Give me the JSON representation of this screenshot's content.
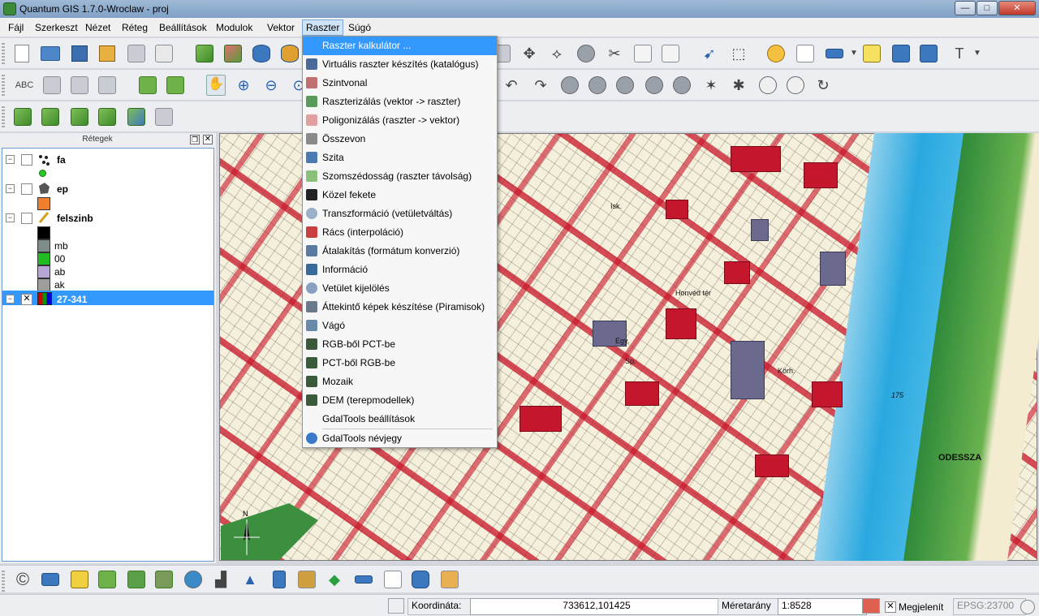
{
  "window": {
    "title": "Quantum GIS 1.7.0-Wroclaw - proj",
    "controls": {
      "minimize": "—",
      "maximize": "□",
      "close": "✕"
    }
  },
  "menubar": {
    "items": [
      "Fájl",
      "Szerkeszt",
      "Nézet",
      "Réteg",
      "Beállítások",
      "Modulok",
      "Vektor",
      "Raszter",
      "Súgó"
    ],
    "active": "Raszter"
  },
  "raster_menu": {
    "items": [
      {
        "label": "Raszter kalkulátor ...",
        "icon": "calculator-icon",
        "highlighted": true
      },
      {
        "label": "Virtuális raszter készítés (katalógus)",
        "icon": "virtual-raster-icon"
      },
      {
        "label": "Szintvonal",
        "icon": "contour-icon"
      },
      {
        "label": "Raszterizálás (vektor -> raszter)",
        "icon": "rasterize-icon"
      },
      {
        "label": "Poligonizálás (raszter -> vektor)",
        "icon": "polygonize-icon"
      },
      {
        "label": "Összevon",
        "icon": "merge-icon"
      },
      {
        "label": "Szita",
        "icon": "sieve-icon"
      },
      {
        "label": "Szomszédosság (raszter távolság)",
        "icon": "proximity-icon"
      },
      {
        "label": "Közel fekete",
        "icon": "nearblack-icon"
      },
      {
        "label": "Transzformáció (vetületváltás)",
        "icon": "warp-icon"
      },
      {
        "label": "Rács (interpoláció)",
        "icon": "grid-icon"
      },
      {
        "label": "Átalakítás (formátum konverzió)",
        "icon": "translate-icon"
      },
      {
        "label": "Információ",
        "icon": "info-icon"
      },
      {
        "label": "Vetület kijelölés",
        "icon": "projection-icon"
      },
      {
        "label": "Áttekintő képek készítése (Piramisok)",
        "icon": "overview-icon"
      },
      {
        "label": "Vágó",
        "icon": "clipper-icon"
      },
      {
        "label": "RGB-ből PCT-be",
        "icon": "rgb-pct-icon"
      },
      {
        "label": "PCT-ből RGB-be",
        "icon": "pct-rgb-icon"
      },
      {
        "label": "Mozaik",
        "icon": "tileindex-icon"
      },
      {
        "label": "DEM (terepmodellek)",
        "icon": "dem-icon"
      },
      {
        "label": "GdalTools beállítások",
        "icon": ""
      },
      {
        "label": "GdalTools névjegy",
        "icon": "about-icon"
      }
    ]
  },
  "layers_panel": {
    "title": "Rétegek",
    "layers": [
      {
        "name": "fa",
        "checked": false,
        "icon": "point-layer-icon"
      },
      {
        "name": "ep",
        "checked": false,
        "icon": "polygon-layer-icon"
      },
      {
        "name": "felszinb",
        "checked": false,
        "icon": "line-layer-icon"
      },
      {
        "name": "27-341",
        "checked": true,
        "icon": "raster-layer-icon",
        "selected": true
      }
    ],
    "felszinb_legend": [
      {
        "label": "",
        "color": "#000000"
      },
      {
        "label": "mb",
        "color": "#7f8c8c"
      },
      {
        "label": "00",
        "color": "#22bb22"
      },
      {
        "label": "ab",
        "color": "#b7a6d4"
      },
      {
        "label": "ak",
        "color": "#9e9e9e"
      }
    ],
    "ep_color": "#f08030",
    "fa_color": "#22cc22"
  },
  "map": {
    "labels": [
      "Honvéd tér",
      "ODESSZA",
      "Egy.",
      "Sp.",
      "Körh.",
      "Isk.",
      "175"
    ]
  },
  "statusbar": {
    "coord_label": "Koordináta:",
    "coord_value": "733612,101425",
    "scale_label": "Méretarány",
    "scale_value": "1:8528",
    "render_label": "Megjelenít",
    "render_checked": "✕",
    "crs": "EPSG:23700"
  },
  "colors": {
    "highlight": "#3399ff",
    "road": "#c4162c",
    "water": "#29a8e0",
    "park": "#3b8f3f"
  }
}
